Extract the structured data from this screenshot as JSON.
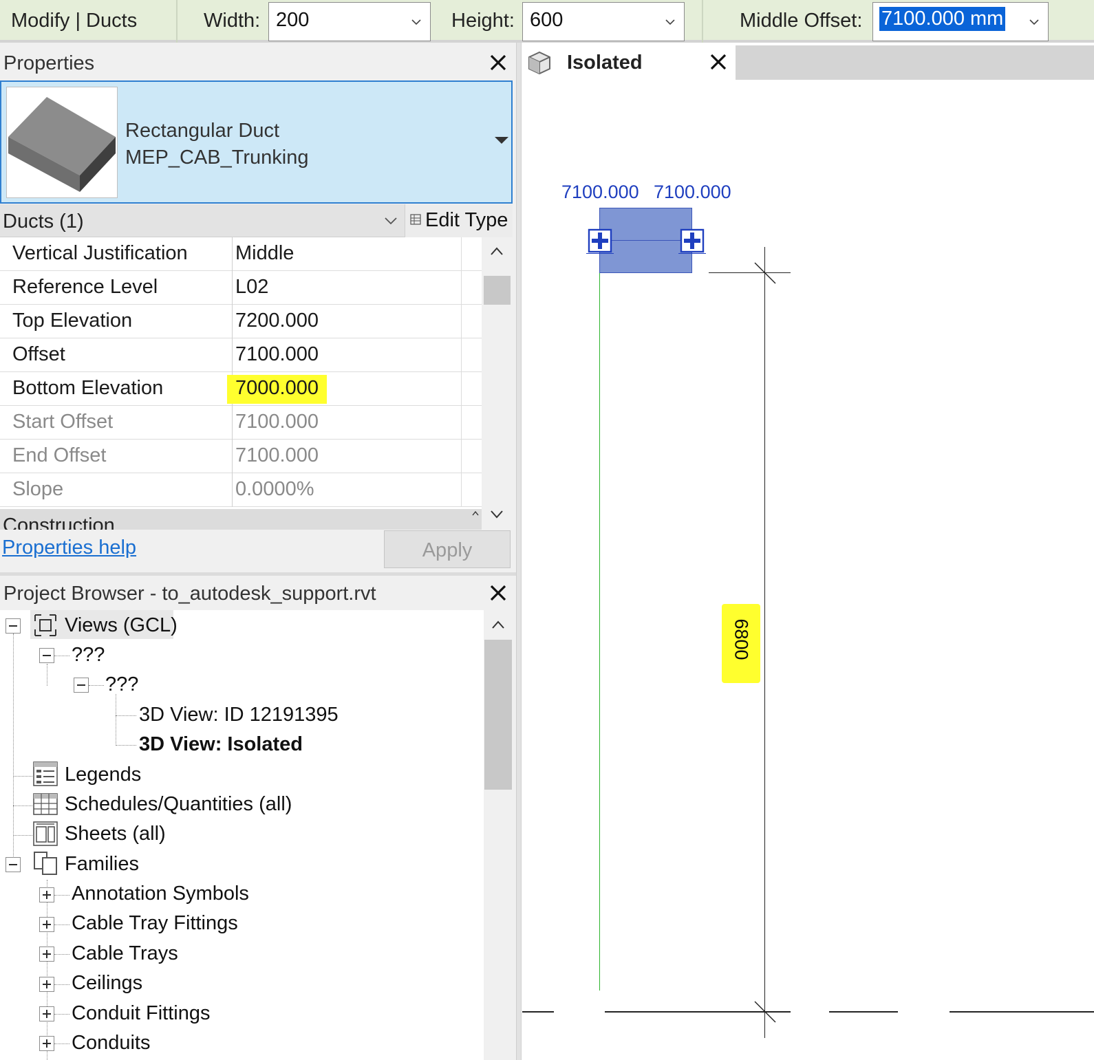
{
  "optionsbar": {
    "context": "Modify | Ducts",
    "width_label": "Width:",
    "width_value": "200",
    "height_label": "Height:",
    "height_value": "600",
    "offset_label": "Middle Offset:",
    "offset_value": "7100.000 mm"
  },
  "properties": {
    "title": "Properties",
    "type_line1": "Rectangular Duct",
    "type_line2": "MEP_CAB_Trunking",
    "filter": "Ducts (1)",
    "edit_type": "Edit Type",
    "rows": [
      {
        "name": "Vertical Justification",
        "value": "Middle"
      },
      {
        "name": "Reference Level",
        "value": "L02"
      },
      {
        "name": "Top Elevation",
        "value": "7200.000"
      },
      {
        "name": "Offset",
        "value": "7100.000"
      },
      {
        "name": "Bottom Elevation",
        "value": "7000.000"
      },
      {
        "name": "Start Offset",
        "value": "7100.000"
      },
      {
        "name": "End Offset",
        "value": "7100.000"
      },
      {
        "name": "Slope",
        "value": "0.0000%"
      }
    ],
    "group_header": "Construction",
    "help_link": "Properties help",
    "apply": "Apply"
  },
  "browser": {
    "title": "Project Browser - to_autodesk_support.rvt",
    "views": "Views (GCL)",
    "level1": "???",
    "level2": "???",
    "view_a": "3D View: ID 12191395",
    "view_b": "3D View: Isolated",
    "legends": "Legends",
    "schedules": "Schedules/Quantities (all)",
    "sheets": "Sheets (all)",
    "families": "Families",
    "family_items": [
      "Annotation Symbols",
      "Cable Tray Fittings",
      "Cable Trays",
      "Ceilings",
      "Conduit Fittings",
      "Conduits"
    ]
  },
  "view": {
    "tab_label": "Isolated",
    "dim_left": "7100.000",
    "dim_right": "7100.000",
    "dim_vertical": "6800"
  },
  "colors": {
    "highlight": "#ffff2e",
    "selection": "#0a64d8",
    "duct_fill": "#7f96d4",
    "dimension_text": "#1f3fbf"
  }
}
